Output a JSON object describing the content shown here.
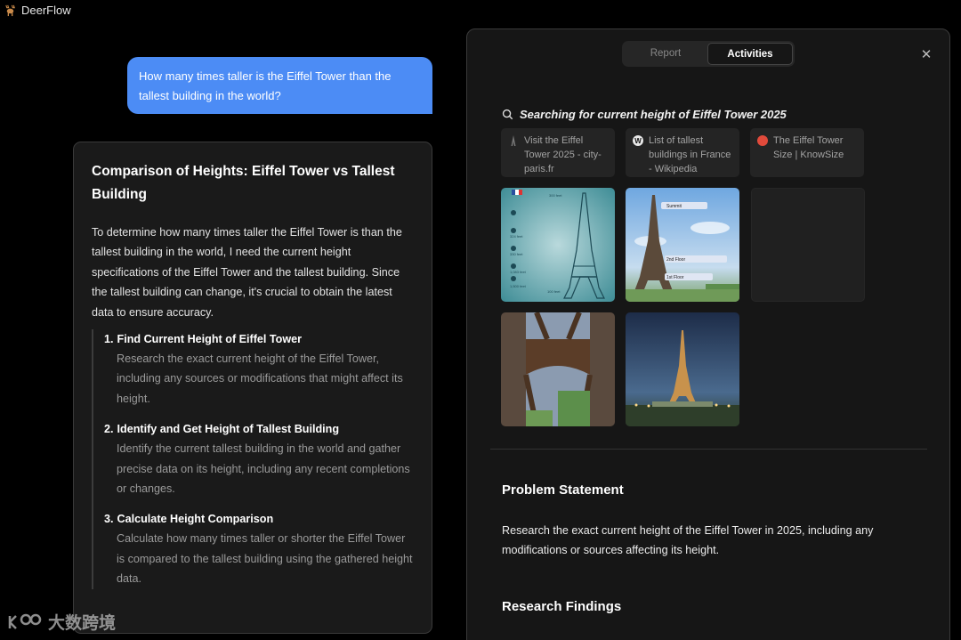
{
  "app": {
    "name": "DeerFlow",
    "logo_icon": "deer-logo-icon"
  },
  "chat": {
    "user_message": "How many times taller is the Eiffel Tower than the tallest building in the world?"
  },
  "plan": {
    "title": "Comparison of Heights: Eiffel Tower vs Tallest Building",
    "intro": "To determine how many times taller the Eiffel Tower is than the tallest building in the world, I need the current height specifications of the Eiffel Tower and the tallest building. Since the tallest building can change, it's crucial to obtain the latest data to ensure accuracy.",
    "steps": [
      {
        "num": "1.",
        "title": "Find Current Height of Eiffel Tower",
        "desc": "Research the exact current height of the Eiffel Tower, including any sources or modifications that might affect its height."
      },
      {
        "num": "2.",
        "title": "Identify and Get Height of Tallest Building",
        "desc": "Identify the current tallest building in the world and gather precise data on its height, including any recent completions or changes."
      },
      {
        "num": "3.",
        "title": "Calculate Height Comparison",
        "desc": "Calculate how many times taller or shorter the Eiffel Tower is compared to the tallest building using the gathered height data."
      }
    ]
  },
  "panel": {
    "tabs": [
      {
        "label": "Report"
      },
      {
        "label": "Activities"
      }
    ],
    "active_tab": "Activities",
    "close_icon": "close-icon",
    "search": {
      "icon": "search-icon",
      "text": "Searching for current height of Eiffel Tower 2025"
    },
    "results": [
      {
        "title": "Visit the Eiffel Tower 2025 - city-paris.fr",
        "favicon": "tower-favicon-icon"
      },
      {
        "title": "List of tallest buildings in France - Wikipedia",
        "favicon": "wikipedia-favicon-icon"
      },
      {
        "title": "The Eiffel Tower Size | KnowSize",
        "favicon": "knowsize-favicon-icon"
      }
    ],
    "images": [
      {
        "name": "eiffel-infographic-image",
        "labels": [
          "300 feet",
          "324 feet",
          "330 feet",
          "1,083 feet",
          "1,500 feet",
          "100 feet"
        ]
      },
      {
        "name": "eiffel-floors-image",
        "labels": [
          "Summit",
          "2nd Floor",
          "1st Floor"
        ]
      },
      {
        "name": "image-placeholder"
      },
      {
        "name": "eiffel-underside-image"
      },
      {
        "name": "eiffel-night-image"
      }
    ],
    "problem_heading": "Problem Statement",
    "problem_text": "Research the exact current height of the Eiffel Tower in 2025, including any modifications or sources affecting its height.",
    "findings_heading": "Research Findings"
  },
  "watermark": {
    "text": "大数跨境"
  }
}
